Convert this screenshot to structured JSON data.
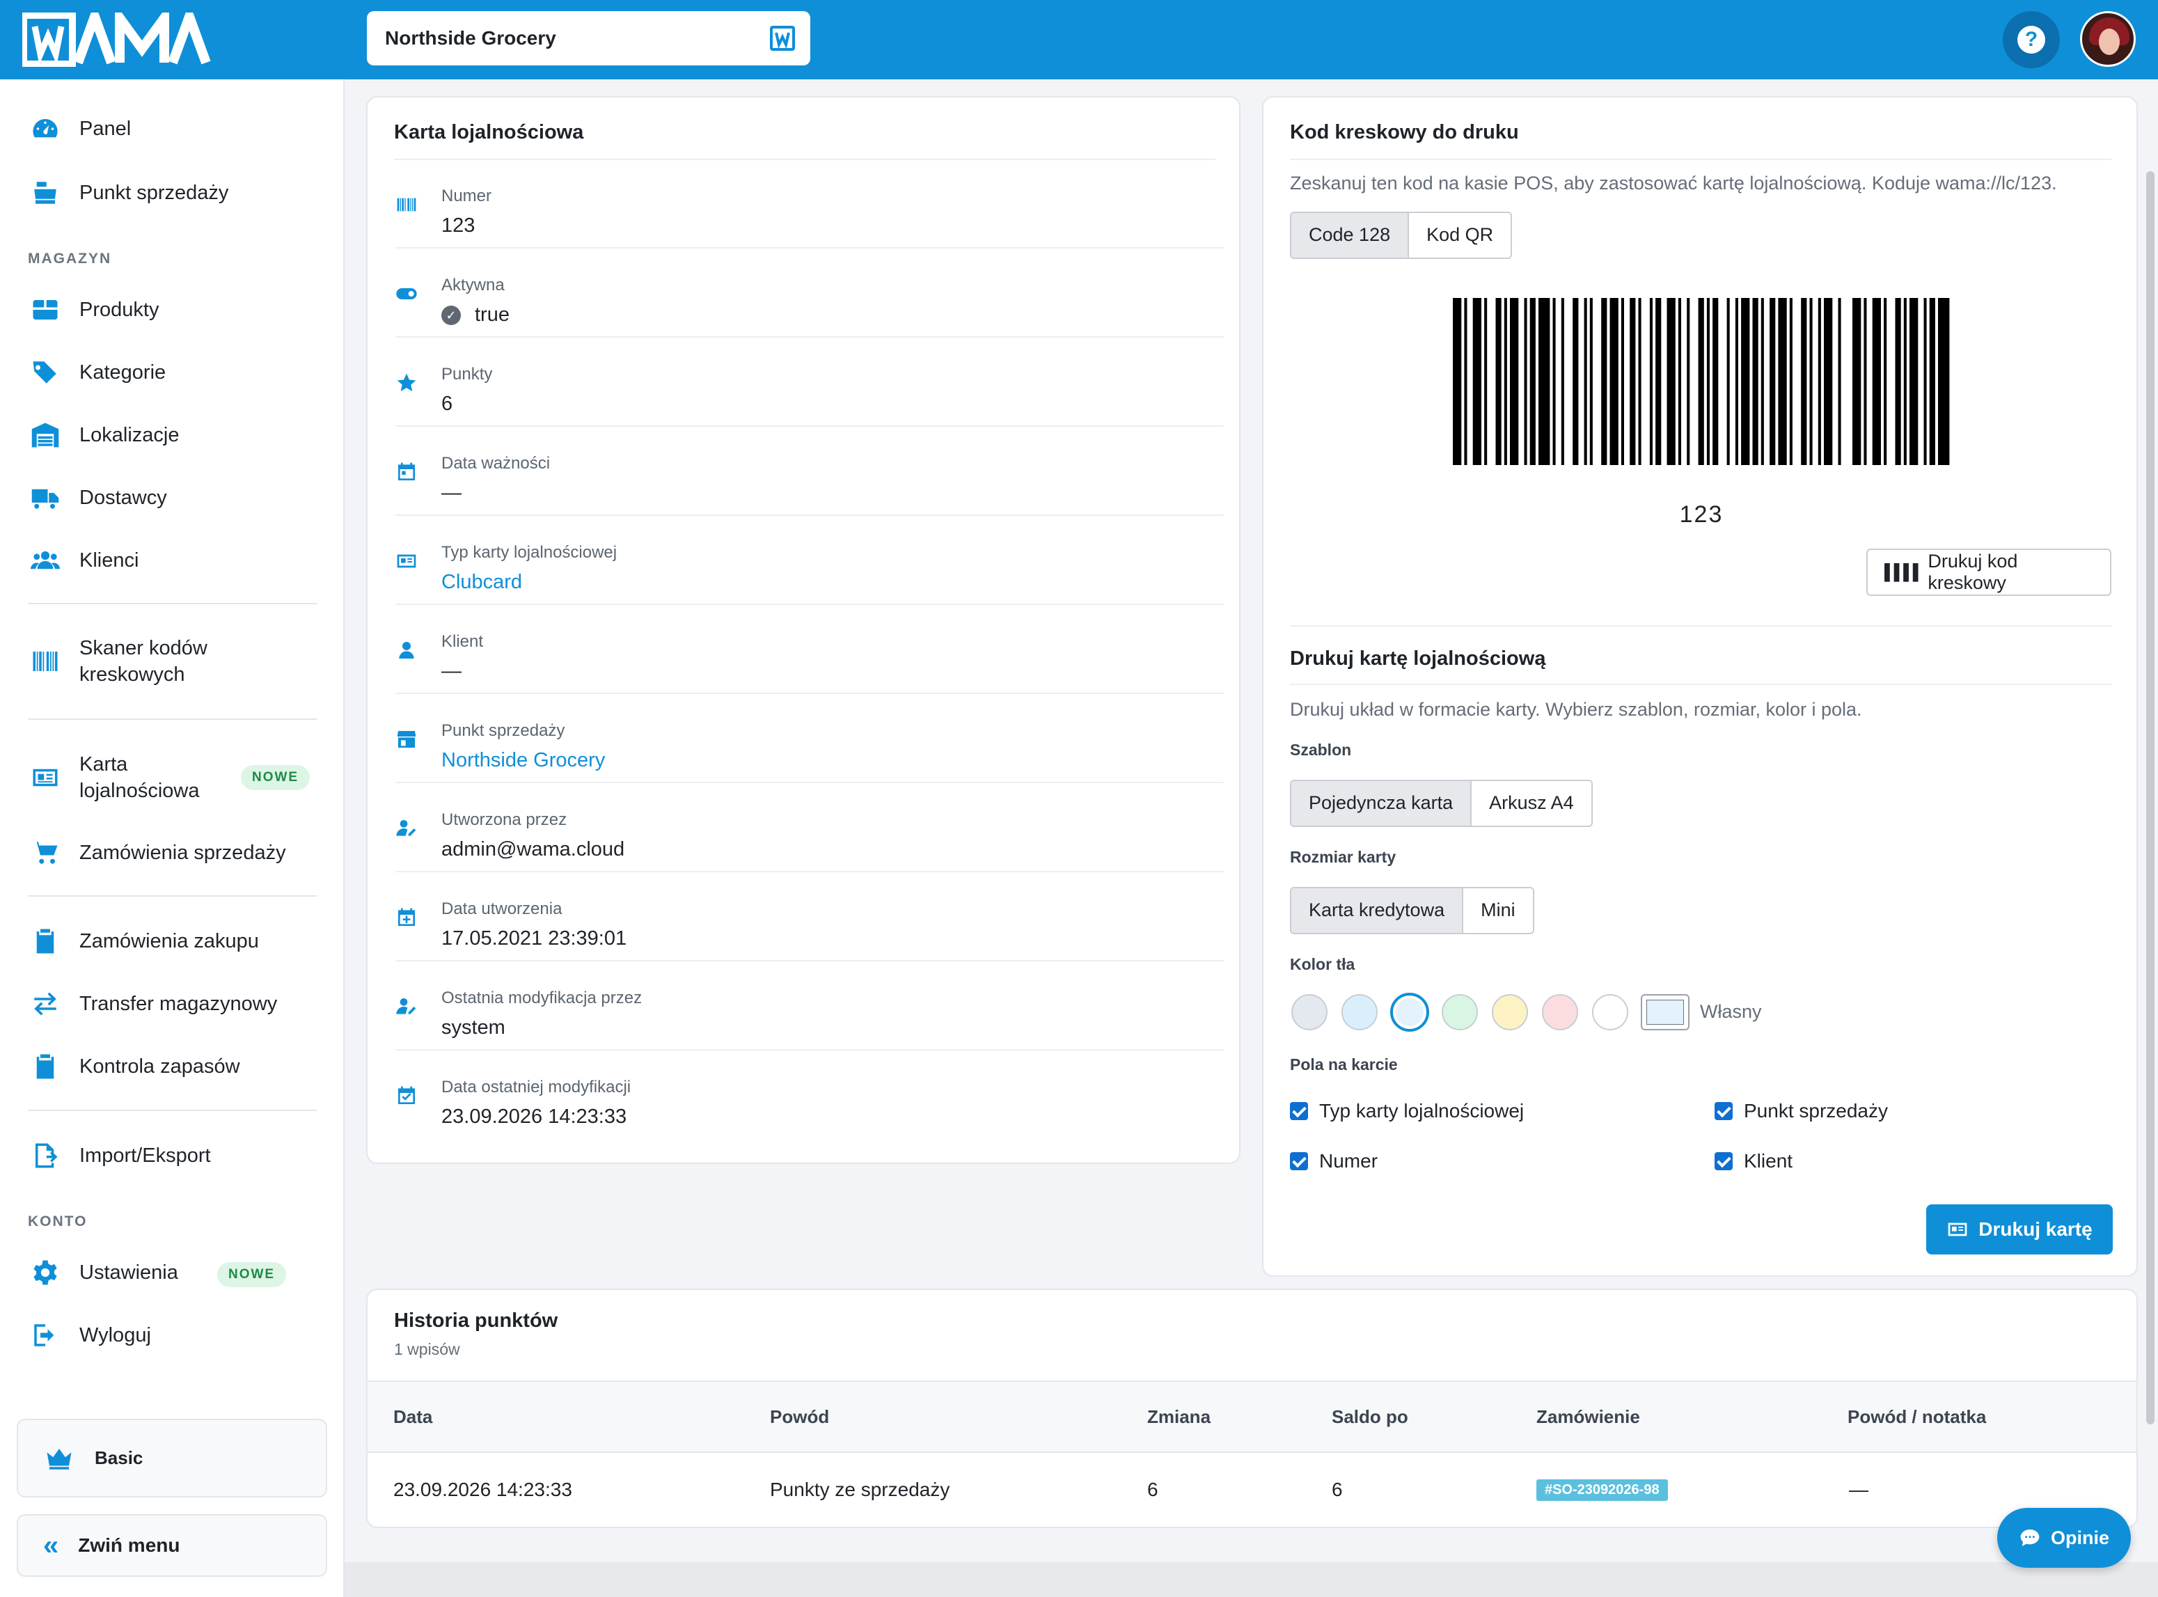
{
  "brand": {
    "logo_text": "WAMA",
    "accent": "#0f8fd8"
  },
  "topbar": {
    "store_name": "Northside Grocery"
  },
  "sidebar": {
    "items_top": [
      {
        "label": "Panel",
        "icon": "gauge-icon"
      },
      {
        "label": "Punkt sprzedaży",
        "icon": "cash-register-icon"
      }
    ],
    "section_magazyn": "MAGAZYN",
    "items_magazyn": [
      {
        "label": "Produkty",
        "icon": "box-icon"
      },
      {
        "label": "Kategorie",
        "icon": "tags-icon"
      },
      {
        "label": "Lokalizacje",
        "icon": "warehouse-icon"
      },
      {
        "label": "Dostawcy",
        "icon": "truck-icon"
      },
      {
        "label": "Klienci",
        "icon": "users-icon"
      }
    ],
    "scanner_label": "Skaner kodów\nkreskowych",
    "loyalty_label": "Karta\nlojalnościowa",
    "loyalty_badge": "NOWE",
    "sales_orders_label": "Zamówienia sprzedaży",
    "items_purchase": [
      {
        "label": "Zamówienia zakupu",
        "icon": "clipboard-icon"
      },
      {
        "label": "Transfer magazynowy",
        "icon": "transfer-icon"
      },
      {
        "label": "Kontrola zapasów",
        "icon": "clipboard-check-icon"
      }
    ],
    "import_export_label": "Import/Eksport",
    "section_konto": "KONTO",
    "settings_label": "Ustawienia",
    "settings_badge": "NOWE",
    "logout_label": "Wyloguj",
    "plan_label": "Basic",
    "collapse_label": "Zwiń menu"
  },
  "loyalty_card": {
    "title": "Karta lojalnościowa",
    "fields": [
      {
        "label": "Numer",
        "value": "123",
        "icon": "barcode-icon",
        "link": false
      },
      {
        "label": "Aktywna",
        "value": "true",
        "icon": "toggle-icon",
        "link": false
      },
      {
        "label": "Punkty",
        "value": "6",
        "icon": "star-icon",
        "link": false
      },
      {
        "label": "Data ważności",
        "value": "—",
        "icon": "calendar-icon",
        "link": false
      },
      {
        "label": "Typ karty lojalnościowej",
        "value": "Clubcard",
        "icon": "id-card-icon",
        "link": true
      },
      {
        "label": "Klient",
        "value": "—",
        "icon": "user-icon",
        "link": false
      },
      {
        "label": "Punkt sprzedaży",
        "value": "Northside Grocery",
        "icon": "store-icon",
        "link": true
      },
      {
        "label": "Utworzona przez",
        "value": "admin@wama.cloud",
        "icon": "user-edit-icon",
        "link": false
      },
      {
        "label": "Data utworzenia",
        "value": "17.05.2021 23:39:01",
        "icon": "calendar-plus-icon",
        "link": false
      },
      {
        "label": "Ostatnia modyfikacja przez",
        "value": "system",
        "icon": "user-edit-icon",
        "link": false
      },
      {
        "label": "Data ostatniej modyfikacji",
        "value": "23.09.2026 14:23:33",
        "icon": "calendar-check-icon",
        "link": false
      }
    ]
  },
  "barcode_panel": {
    "title": "Kod kreskowy do druku",
    "description": "Zeskanuj ten kod na kasie POS, aby zastosować kartę lojalnościową. Koduje wama://lc/123.",
    "tabs": [
      "Code 128",
      "Kod QR"
    ],
    "active_tab": "Code 128",
    "barcode_value": "123",
    "print_barcode_label": "Drukuj kod kreskowy"
  },
  "print_card": {
    "title": "Drukuj kartę lojalnościową",
    "description": "Drukuj układ w formacie karty. Wybierz szablon, rozmiar, kolor i pola.",
    "template_label": "Szablon",
    "template_options": [
      "Pojedyncza karta",
      "Arkusz A4"
    ],
    "size_label": "Rozmiar karty",
    "size_options": [
      "Karta kredytowa",
      "Mini"
    ],
    "color_label": "Kolor tła",
    "colors": [
      "#e4e9f0",
      "#dbeefc",
      "#e3f2fd",
      "#d9f5e3",
      "#fdf2c4",
      "#fbdde0",
      "#ffffff"
    ],
    "selected_color_index": 2,
    "custom_color_label": "Własny",
    "fields_label": "Pola na karcie",
    "checkboxes": [
      "Typ karty lojalnościowej",
      "Punkt sprzedaży",
      "Numer",
      "Klient"
    ],
    "print_button": "Drukuj kartę"
  },
  "history": {
    "title": "Historia punktów",
    "count": "1 wpisów",
    "columns": [
      "Data",
      "Powód",
      "Zmiana",
      "Saldo po",
      "Zamówienie",
      "Powód / notatka"
    ],
    "rows": [
      {
        "date": "23.09.2026 14:23:33",
        "reason": "Punkty ze sprzedaży",
        "change": "6",
        "balance": "6",
        "order": "#SO-23092026-98",
        "note": "—"
      }
    ]
  },
  "feedback_label": "Opinie"
}
